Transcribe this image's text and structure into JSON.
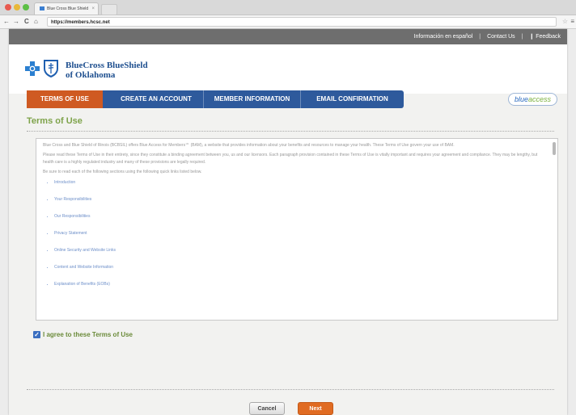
{
  "browser": {
    "tab_title": "Blue Cross Blue Shield",
    "tab_close": "×",
    "url": "https://members.hcsc.net",
    "back_label": "←",
    "forward_label": "→",
    "reload_label": "C",
    "home_label": "⌂",
    "star_label": "☆",
    "menu_label": "≡"
  },
  "topbar": {
    "spanish_link": "Información en español",
    "contact_link": "Contact Us",
    "feedback_link": "Feedback",
    "separator": "|",
    "feedback_icon": "❙"
  },
  "logo": {
    "line1": "BlueCross BlueShield",
    "line2": "of Oklahoma"
  },
  "steps": [
    {
      "label": "TERMS OF USE"
    },
    {
      "label": "CREATE AN ACCOUNT"
    },
    {
      "label": "MEMBER INFORMATION"
    },
    {
      "label": "EMAIL CONFIRMATION"
    }
  ],
  "blueaccess": {
    "part1": "blue",
    "part2": "access"
  },
  "page_title": "Terms of Use",
  "terms": {
    "para1": "Blue Cross and Blue Shield of Illinois (BCBSIL) offers Blue Access for Members℠ (BAM), a website that provides information about your benefits and resources to manage your health. These Terms of Use govern your use of BAM.",
    "para2": "Please read these Terms of Use in their entirety, since they constitute a binding agreement between you, us and our licensors. Each paragraph provision contained in these Terms of Use is vitally important and requires your agreement and compliance. They may be lengthy, but health care is a highly regulated industry and many of these provisions are legally required.",
    "para3": "Be sure to read each of the following sections using the following quick links listed below.",
    "links": [
      "Introduction",
      "Your Responsibilities",
      "Our Responsibilities",
      "Privacy Statement",
      "Online Security and Website Links",
      "Content and Website Information",
      "Explanation of Benefits (EOBs)"
    ]
  },
  "agree_label": "I agree to these Terms of Use",
  "agree_check": "✓",
  "buttons": {
    "cancel": "Cancel",
    "next": "Next"
  },
  "colors": {
    "step_active": "#cf5a22",
    "step_inactive": "#2e5a9c",
    "title_green": "#7ea34a",
    "next_orange": "#e06b22"
  }
}
